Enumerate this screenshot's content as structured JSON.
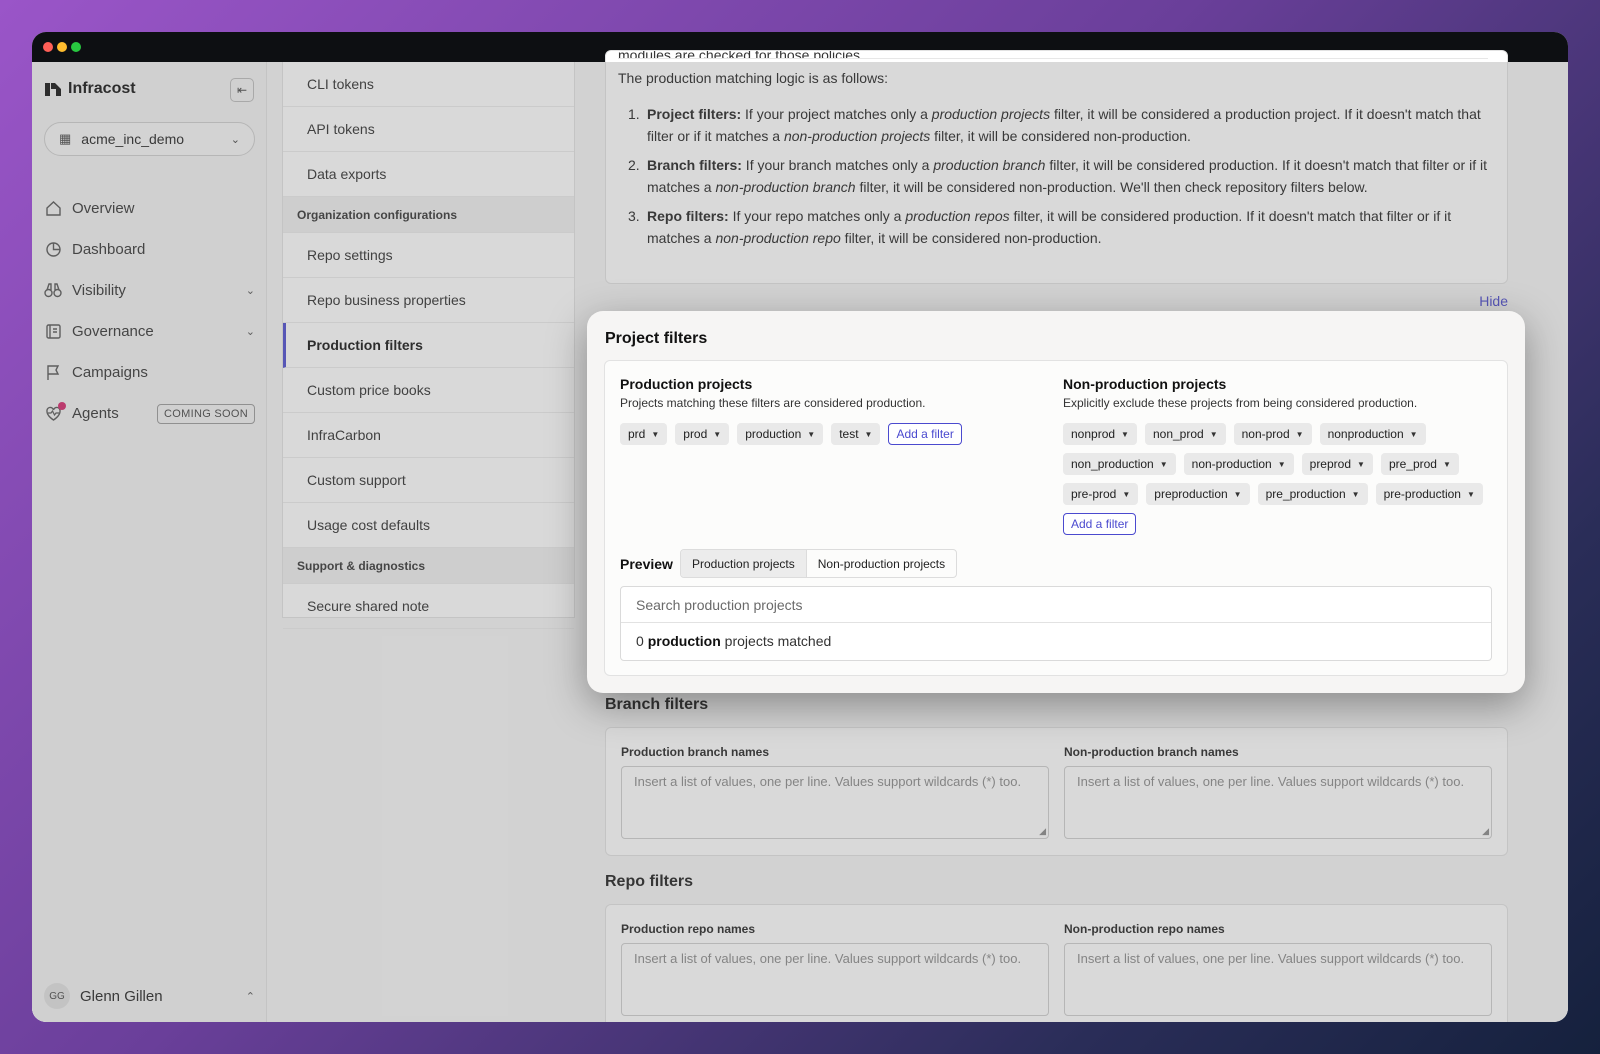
{
  "sidebar": {
    "brand": "Infracost",
    "org": "acme_inc_demo",
    "items": [
      {
        "label": "Overview",
        "icon": "home-icon"
      },
      {
        "label": "Dashboard",
        "icon": "pie-chart-icon"
      },
      {
        "label": "Visibility",
        "icon": "binoculars-icon"
      },
      {
        "label": "Governance",
        "icon": "book-icon"
      },
      {
        "label": "Campaigns",
        "icon": "flag-icon"
      },
      {
        "label": "Agents",
        "icon": "heart-pulse-icon",
        "badge": "COMING SOON"
      }
    ],
    "user": {
      "initials": "GG",
      "name": "Glenn Gillen"
    }
  },
  "settings_menu": {
    "top_items": [
      "CLI tokens",
      "API tokens",
      "Data exports"
    ],
    "org_heading": "Organization configurations",
    "org_items": [
      "Repo settings",
      "Repo business properties",
      "Production filters",
      "Custom price books",
      "InfraCarbon",
      "Custom support",
      "Usage cost defaults"
    ],
    "support_heading": "Support & diagnostics",
    "support_items": [
      "Secure shared note"
    ],
    "active": "Production filters"
  },
  "info": {
    "clipped": "modules are checked for those policies.",
    "intro": "The production matching logic is as follows:",
    "rules": [
      {
        "num": "1.",
        "title": "Project filters:",
        "t1": " If your project matches only a ",
        "e1": "production projects",
        "t2": " filter, it will be considered a production project. If it doesn't match that filter or if it matches a ",
        "e2": "non-production projects",
        "t3": " filter, it will be considered non-production."
      },
      {
        "num": "2.",
        "title": "Branch filters:",
        "t1": " If your branch matches only a ",
        "e1": "production branch",
        "t2": " filter, it will be considered production. If it doesn't match that filter or if it matches a ",
        "e2": "non-production branch",
        "t3": " filter, it will be considered non-production. We'll then check repository filters below."
      },
      {
        "num": "3.",
        "title": "Repo filters:",
        "t1": " If your repo matches only a ",
        "e1": "production repos",
        "t2": " filter, it will be considered production. If it doesn't match that filter or if it matches a ",
        "e2": "non-production repo",
        "t3": " filter, it will be considered non-production."
      }
    ],
    "hide": "Hide"
  },
  "project_filters": {
    "title": "Project filters",
    "prod_heading": "Production projects",
    "prod_sub": "Projects matching these filters are considered production.",
    "prod_chips": [
      "prd",
      "prod",
      "production",
      "test"
    ],
    "nonprod_heading": "Non-production projects",
    "nonprod_sub": "Explicitly exclude these projects from being considered production.",
    "nonprod_chips": [
      "nonprod",
      "non_prod",
      "non-prod",
      "nonproduction",
      "non_production",
      "non-production",
      "preprod",
      "pre_prod",
      "pre-prod",
      "preproduction",
      "pre_production",
      "pre-production"
    ],
    "add_filter": "Add a filter",
    "preview_label": "Preview",
    "tabs": [
      "Production projects",
      "Non-production projects"
    ],
    "search_placeholder": "Search production projects",
    "matched_count": "0",
    "matched_word": "production",
    "matched_suffix": " projects matched"
  },
  "branch_filters": {
    "title": "Branch filters",
    "prod_label": "Production branch names",
    "nonprod_label": "Non-production branch names",
    "placeholder": "Insert a list of values, one per line. Values support wildcards (*) too."
  },
  "repo_filters": {
    "title": "Repo filters",
    "prod_label": "Production repo names",
    "nonprod_label": "Non-production repo names",
    "placeholder": "Insert a list of values, one per line. Values support wildcards (*) too."
  },
  "colors": {
    "accent": "#4b4acf",
    "notification": "#d6246b"
  }
}
